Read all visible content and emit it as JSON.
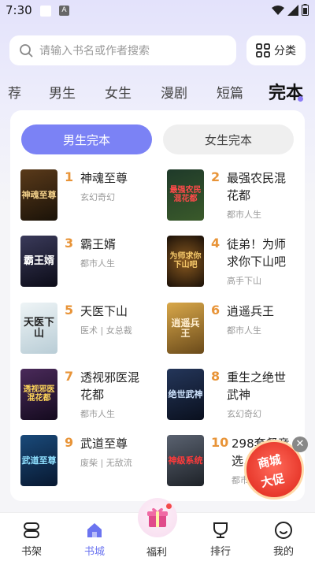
{
  "status": {
    "time": "7:30",
    "notif_icon": "A"
  },
  "search": {
    "placeholder": "请输入书名或作者搜索"
  },
  "category": {
    "label": "分类"
  },
  "tabs": [
    {
      "label": "荐"
    },
    {
      "label": "男生"
    },
    {
      "label": "女生"
    },
    {
      "label": "漫剧"
    },
    {
      "label": "短篇"
    },
    {
      "label": "完本",
      "active": true
    }
  ],
  "segments": {
    "male": "男生完本",
    "female": "女生完本"
  },
  "books": [
    {
      "rank": "1",
      "title": "神魂至尊",
      "tags": "玄幻奇幻",
      "cover_text": "神魂至尊",
      "cover_bg": "#3a2a1a",
      "cover_fg": "#f2d08a"
    },
    {
      "rank": "2",
      "title": "最强农民混花都",
      "tags": "都市人生",
      "cover_text": "最强农民混花都",
      "cover_bg": "#1f3a2a",
      "cover_fg": "#ff4a4a"
    },
    {
      "rank": "3",
      "title": "霸王婿",
      "tags": "都市人生",
      "cover_text": "霸王婿",
      "cover_bg": "#1c1c2e",
      "cover_fg": "#ffffff"
    },
    {
      "rank": "4",
      "title": "徒弟！为师求你下山吧",
      "tags": "高手下山",
      "cover_text": "为师求你下山吧",
      "cover_bg": "#2a1e10",
      "cover_fg": "#f5c86a"
    },
    {
      "rank": "5",
      "title": "天医下山",
      "tags": "医术 | 女总裁",
      "cover_text": "天医下山",
      "cover_bg": "#dfe9ee",
      "cover_fg": "#222222"
    },
    {
      "rank": "6",
      "title": "逍遥兵王",
      "tags": "都市人生",
      "cover_text": "逍遥兵王",
      "cover_bg": "#b88a3a",
      "cover_fg": "#ffeed0"
    },
    {
      "rank": "7",
      "title": "透视邪医混花都",
      "tags": "都市人生",
      "cover_text": "透视邪医混花都",
      "cover_bg": "#2a1a3a",
      "cover_fg": "#ffd75a"
    },
    {
      "rank": "8",
      "title": "重生之绝世武神",
      "tags": "玄幻奇幻",
      "cover_text": "绝世武神",
      "cover_bg": "#12203a",
      "cover_fg": "#cfe4ff"
    },
    {
      "rank": "9",
      "title": "武道至尊",
      "tags": "废柴 | 无敌流",
      "cover_text": "武道至尊",
      "cover_bg": "#0f2f5a",
      "cover_fg": "#8fe0ff"
    },
    {
      "rank": "10",
      "title": "298套餐竟选...",
      "tags": "都市...",
      "cover_text": "神级系统",
      "cover_bg": "#3a3f4a",
      "cover_fg": "#ff3a3a"
    }
  ],
  "promo": {
    "line1": "商城",
    "line2": "大促"
  },
  "nav": {
    "bookshelf": "书架",
    "store": "书城",
    "welfare": "福利",
    "ranking": "排行",
    "mine": "我的"
  }
}
